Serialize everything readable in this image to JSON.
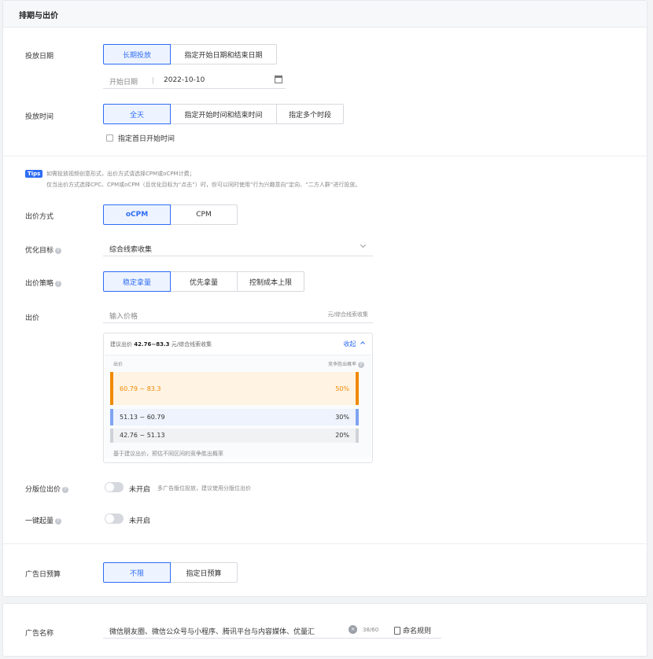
{
  "section_title": "排期与出价",
  "schedule": {
    "date_label": "投放日期",
    "date_options": [
      "长期投放",
      "指定开始日期和结束日期"
    ],
    "start_date_label": "开始日期",
    "start_date_value": "2022-10-10",
    "time_label": "投放时间",
    "time_options": [
      "全天",
      "指定开始时间和结束时间",
      "指定多个时段"
    ],
    "first_day_checkbox": "指定首日开始时间"
  },
  "tips": {
    "badge": "Tips",
    "line1": "如需投放视频创意形式，出价方式请选择CPM或oCPM计费；",
    "line2": "仅当出价方式选择CPC、CPM或oCPM（且优化目标为“点击”）时，你可以同时使用“行为兴趣意向”定向、“二方人群”进行投放。"
  },
  "bid_method": {
    "label": "出价方式",
    "options": [
      "oCPM",
      "CPM"
    ]
  },
  "optimize": {
    "label": "优化目标",
    "value": "综合线索收集"
  },
  "strategy": {
    "label": "出价策略",
    "options": [
      "稳定拿量",
      "优先拿量",
      "控制成本上限"
    ]
  },
  "bid": {
    "label": "出价",
    "placeholder": "输入价格",
    "unit": "元/综合线索收集",
    "suggest_prefix": "建议出价",
    "suggest_range": "42.76~83.3",
    "suggest_unit": "元/综合线索收集",
    "collapse": "收起",
    "col_bid": "出价",
    "col_rate": "竞争胜出概率",
    "rows": [
      {
        "range": "60.79 ~ 83.3",
        "pct": "50%",
        "share": 0.5
      },
      {
        "range": "51.13 ~ 60.79",
        "pct": "30%",
        "share": 0.3
      },
      {
        "range": "42.76 ~ 51.13",
        "pct": "20%",
        "share": 0.2
      }
    ],
    "footnote": "基于建议出价，预估不同区间的竞争胜出概率"
  },
  "tier_bid": {
    "label": "分版位出价",
    "state": "未开启",
    "hint": "多广告版位投放，建议使用分版位出价"
  },
  "one_click": {
    "label": "一键起量",
    "state": "未开启"
  },
  "budget": {
    "label": "广告日预算",
    "options": [
      "不限",
      "指定日预算"
    ]
  },
  "ad_name": {
    "label": "广告名称",
    "value": "微信朋友圈、微信公众号与小程序、腾讯平台与内容媒体、优量汇",
    "counter": "38/60",
    "rule": "命名规则"
  },
  "colors": {
    "primary": "#2d6cf5",
    "orange": "#f08a00",
    "blue_bar": "#7ea4f2",
    "grey_bar": "#cfd2d7"
  }
}
